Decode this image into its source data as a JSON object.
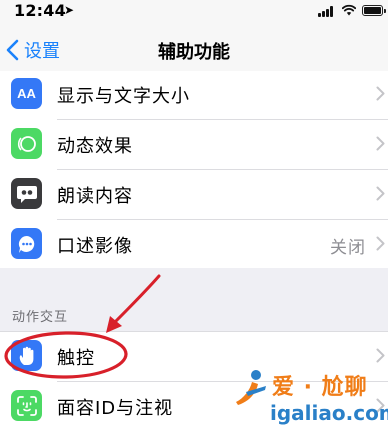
{
  "status_bar": {
    "time": "12:44"
  },
  "nav": {
    "back_label": "设置",
    "title": "辅助功能"
  },
  "vision_rows": [
    {
      "label": "显示与文字大小",
      "value": "",
      "icon": "text-size-icon",
      "icon_text": "AA",
      "color": "#3478f6"
    },
    {
      "label": "动态效果",
      "value": "",
      "icon": "motion-icon",
      "icon_text": "",
      "color": "#4cd964"
    },
    {
      "label": "朗读内容",
      "value": "",
      "icon": "spoken-content-icon",
      "icon_text": "",
      "color": "#3a3a3c"
    },
    {
      "label": "口述影像",
      "value": "关闭",
      "icon": "audio-description-icon",
      "icon_text": "",
      "color": "#3478f6"
    }
  ],
  "section": {
    "header": "动作交互"
  },
  "interaction_rows": [
    {
      "label": "触控",
      "value": "",
      "icon": "hand-touch-icon",
      "color": "#3478f6"
    },
    {
      "label": "面容ID与注视",
      "value": "",
      "icon": "face-id-icon",
      "color": "#4cd964"
    }
  ],
  "watermark": {
    "line1": "爱 · 尬聊",
    "line2": "igaliao.com"
  },
  "colors": {
    "accent": "#1a82fb",
    "annotation": "#d8202a"
  }
}
